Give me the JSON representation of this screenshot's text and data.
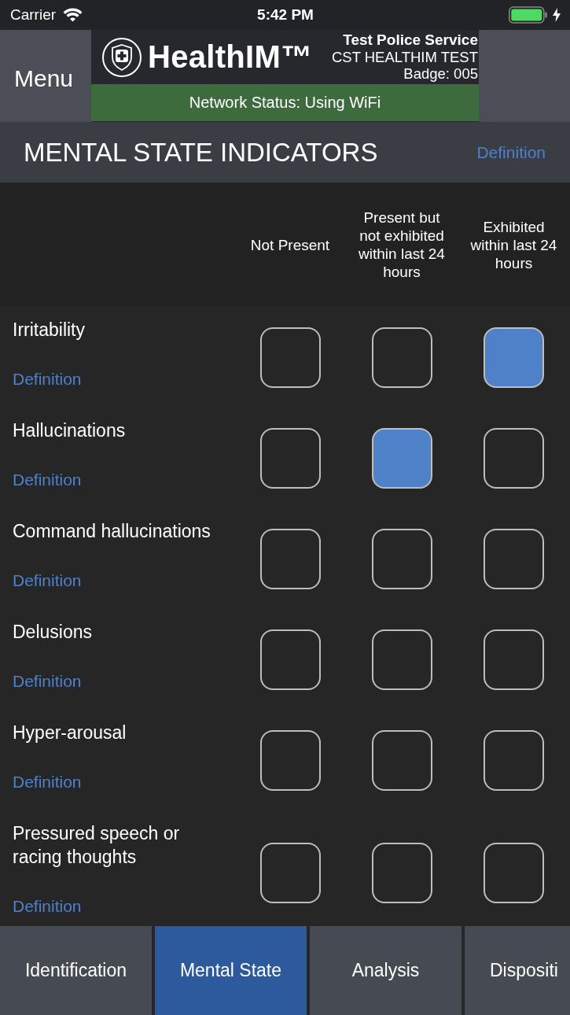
{
  "status_bar": {
    "carrier": "Carrier",
    "time": "5:42 PM"
  },
  "header": {
    "menu": "Menu",
    "logo_text": "HealthIM™",
    "agency": "Test Police Service",
    "unit": "CST HEALTHIM TEST",
    "badge": "Badge: 005",
    "network_status": "Network Status: Using WiFi"
  },
  "section": {
    "title": "MENTAL STATE INDICATORS",
    "link": "Definition"
  },
  "columns": [
    "Not Present",
    "Present but not exhibited within last 24 hours",
    "Exhibited within last 24 hours"
  ],
  "indicators": [
    {
      "label": "Irritability",
      "link": "Definition",
      "options": [
        {
          "checked": false
        },
        {
          "checked": false
        },
        {
          "checked": true
        }
      ]
    },
    {
      "label": "Hallucinations",
      "link": "Definition",
      "options": [
        {
          "checked": false
        },
        {
          "checked": true
        },
        {
          "checked": false
        }
      ]
    },
    {
      "label": "Command hallucinations",
      "link": "Definition",
      "options": [
        {
          "checked": false
        },
        {
          "checked": false
        },
        {
          "checked": false
        }
      ]
    },
    {
      "label": "Delusions",
      "link": "Definition",
      "options": [
        {
          "checked": false
        },
        {
          "checked": false
        },
        {
          "checked": false
        }
      ]
    },
    {
      "label": "Hyper-arousal",
      "link": "Definition",
      "options": [
        {
          "checked": false
        },
        {
          "checked": false
        },
        {
          "checked": false
        }
      ]
    },
    {
      "label": "Pressured speech or racing thoughts",
      "link": "Definition",
      "options": [
        {
          "checked": false
        },
        {
          "checked": false
        },
        {
          "checked": false
        }
      ]
    }
  ],
  "tabs": [
    {
      "label": "Identification",
      "selected": false
    },
    {
      "label": "Mental State",
      "selected": true
    },
    {
      "label": "Analysis",
      "selected": false
    },
    {
      "label": "Dispositi",
      "selected": false
    }
  ]
}
